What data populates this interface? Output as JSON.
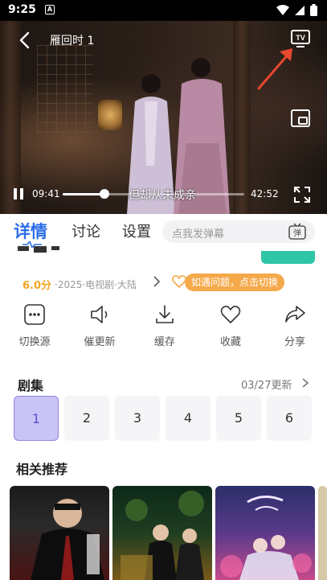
{
  "status_bar": {
    "time": "9:25",
    "notification_badge": "A"
  },
  "player": {
    "title": "雁回时 1",
    "current_time": "09:41",
    "total_time": "42:52",
    "subtitle": "但却从未成亲",
    "progress_fraction": 0.23,
    "icons": {
      "back": "back-arrow-icon",
      "tv": "tv-cast-icon",
      "pip": "picture-in-picture-icon",
      "play_pause": "pause-icon",
      "fullscreen": "fullscreen-icon"
    },
    "tv_label": "TV"
  },
  "tabs": {
    "items": [
      {
        "label": "详情",
        "active": true
      },
      {
        "label": "讨论",
        "active": false
      },
      {
        "label": "设置",
        "active": false
      }
    ],
    "danmaku_placeholder": "点我发弹幕",
    "danmaku_icon_label": "弹"
  },
  "info": {
    "rating": "6.0分",
    "meta": "·2025·电视剧·大陆",
    "switch_tip": "如遇问题，点击切换"
  },
  "actions": [
    {
      "label": "切换源",
      "icon": "more-dots-icon"
    },
    {
      "label": "催更新",
      "icon": "speaker-icon"
    },
    {
      "label": "缓存",
      "icon": "download-icon"
    },
    {
      "label": "收藏",
      "icon": "heart-icon"
    },
    {
      "label": "分享",
      "icon": "share-icon"
    }
  ],
  "episodes": {
    "title": "剧集",
    "update_info": "03/27更新",
    "items": [
      "1",
      "2",
      "3",
      "4",
      "5",
      "6"
    ],
    "selected": "1"
  },
  "recommendations": {
    "title": "相关推荐",
    "posters": [
      "poster-1",
      "poster-2",
      "poster-3"
    ]
  },
  "colors": {
    "accent": "#2b6fe8",
    "rating": "#f5a623",
    "tip": "#f5a94a",
    "episode_selected_bg": "#c9c4f5",
    "episode_selected_text": "#5a4fd0",
    "annotation_arrow": "#e5482d"
  }
}
